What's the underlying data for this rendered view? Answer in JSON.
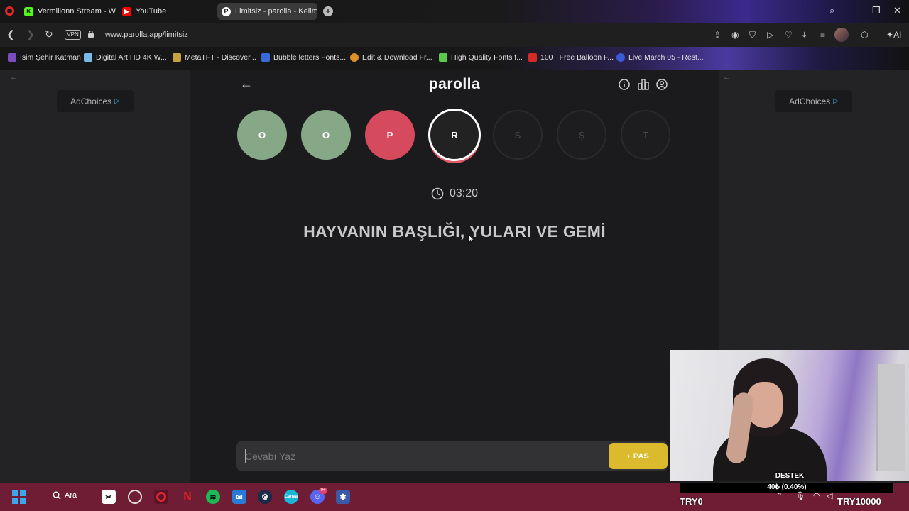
{
  "browser": {
    "tabs": [
      {
        "label": "Vermilionn Stream - Watc",
        "icon": "kick-icon",
        "color": "#53fc18"
      },
      {
        "label": "YouTube",
        "icon": "youtube-icon",
        "color": "#ff0000"
      },
      {
        "label": "Limitsiz - parolla - Kelime",
        "icon": "parolla-favicon",
        "color": "#ffffff",
        "active": true
      }
    ],
    "url": "www.parolla.app/limitsiz",
    "vpn_label": "VPN",
    "ai_label": "AI",
    "bookmarks": [
      {
        "label": "İsim Şehir Katman",
        "color": "#7a4cc0",
        "icon": "isim-sehir-icon"
      },
      {
        "label": "Digital Art HD 4K W...",
        "color": "#7ab8e8",
        "icon": "digital-art-icon"
      },
      {
        "label": "MetaTFT - Discover...",
        "color": "#c8a040",
        "icon": "metatft-icon"
      },
      {
        "label": "Bubble letters Fonts...",
        "color": "#3a6ad8",
        "icon": "bubble-letters-icon"
      },
      {
        "label": "Edit & Download Fr...",
        "color": "#e0902a",
        "icon": "edit-download-icon"
      },
      {
        "label": "High Quality Fonts f...",
        "color": "#5ac84a",
        "icon": "high-quality-fonts-icon"
      },
      {
        "label": "100+ Free Balloon F...",
        "color": "#d62a2a",
        "icon": "balloon-fonts-icon"
      },
      {
        "label": "Live March 05 - Rest...",
        "color": "#3a5ad8",
        "icon": "live-march-icon"
      }
    ]
  },
  "ads": {
    "label": "AdChoices"
  },
  "app": {
    "brand": "parolla",
    "letters": [
      {
        "char": "O",
        "state": "correct"
      },
      {
        "char": "Ö",
        "state": "correct"
      },
      {
        "char": "P",
        "state": "wrong"
      },
      {
        "char": "R",
        "state": "current"
      },
      {
        "char": "S",
        "state": "pending"
      },
      {
        "char": "Ş",
        "state": "pending"
      },
      {
        "char": "T",
        "state": "pending"
      }
    ],
    "timer": "03:20",
    "question": "HAYVANIN BAŞLIĞI, YULARI VE GEMİ",
    "answer_placeholder": "Cevabı Yaz",
    "pass_label": "PAS"
  },
  "overlay": {
    "destek_label": "DESTEK",
    "destek_value": "40₺ (0.40%)",
    "try_left": "TRY0",
    "try_right": "TRY10000"
  },
  "taskbar": {
    "search_label": "Ara",
    "discord_badge": "9+"
  }
}
